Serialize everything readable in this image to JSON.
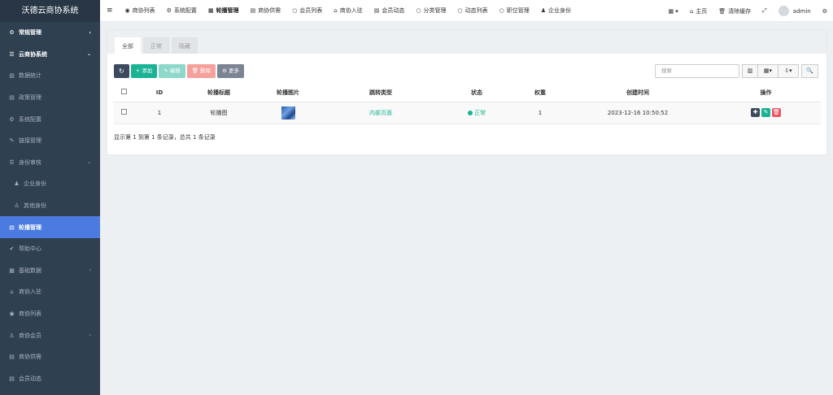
{
  "app": {
    "title": "沃德云商协系统"
  },
  "sidebar": {
    "items": [
      {
        "icon": "⚙",
        "label": "常规管理",
        "arrow": "‹",
        "kind": "head"
      },
      {
        "icon": "☰",
        "label": "云商协系统",
        "arrow": "⌄",
        "kind": "head"
      },
      {
        "icon": "▥",
        "label": "数据统计",
        "kind": ""
      },
      {
        "icon": "▤",
        "label": "政策管理",
        "kind": ""
      },
      {
        "icon": "⚙",
        "label": "系统配置",
        "kind": ""
      },
      {
        "icon": "✎",
        "label": "链接管理",
        "kind": ""
      },
      {
        "icon": "☰",
        "label": "身份审核",
        "arrow": "⌄",
        "kind": ""
      },
      {
        "icon": "♟",
        "label": "企业身份",
        "kind": "sub"
      },
      {
        "icon": "♙",
        "label": "其他身份",
        "kind": "sub"
      },
      {
        "icon": "▤",
        "label": "轮播管理",
        "kind": "active"
      },
      {
        "icon": "✔",
        "label": "帮助中心",
        "kind": ""
      },
      {
        "icon": "▦",
        "label": "基础数据",
        "arrow": "‹",
        "kind": ""
      },
      {
        "icon": "⌂",
        "label": "商协入驻",
        "kind": ""
      },
      {
        "icon": "◉",
        "label": "商协列表",
        "kind": ""
      },
      {
        "icon": "♙",
        "label": "商协会员",
        "arrow": "‹",
        "kind": ""
      },
      {
        "icon": "▤",
        "label": "商协供需",
        "kind": ""
      },
      {
        "icon": "▤",
        "label": "会员动态",
        "kind": ""
      }
    ]
  },
  "topbar": {
    "menu_icon": "≡",
    "items": [
      {
        "icon": "◉",
        "label": "商协列表"
      },
      {
        "icon": "⚙",
        "label": "系统配置"
      },
      {
        "icon": "▦",
        "label": "轮播管理",
        "active": true
      },
      {
        "icon": "▤",
        "label": "商协供需"
      },
      {
        "icon": "○",
        "label": "会员列表"
      },
      {
        "icon": "⌂",
        "label": "商协入驻"
      },
      {
        "icon": "▤",
        "label": "会员动态"
      },
      {
        "icon": "○",
        "label": "分类管理"
      },
      {
        "icon": "○",
        "label": "动态列表"
      },
      {
        "icon": "○",
        "label": "职位管理"
      },
      {
        "icon": "♟",
        "label": "企业身份"
      }
    ],
    "right": {
      "grid": "▦ ▾",
      "home_icon": "⌂",
      "home": "主页",
      "trash_icon": "🗑",
      "clear": "清除缓存",
      "fullscreen": "⤢",
      "user": "admin",
      "settings": "⚙"
    }
  },
  "tabs": [
    {
      "label": "全部",
      "active": true
    },
    {
      "label": "正常"
    },
    {
      "label": "隐藏"
    }
  ],
  "toolbar": {
    "refresh": "↻",
    "add": "+ 添加",
    "edit": "✎ 编辑",
    "delete": "🗑 删除",
    "more": "⚙ 更多"
  },
  "search": {
    "placeholder": "搜索"
  },
  "right_buttons": {
    "list": "▥",
    "columns": "▦▾",
    "export": "⇩▾",
    "search": "🔍"
  },
  "table": {
    "headers": [
      "ID",
      "轮播标题",
      "轮播图片",
      "跳转类型",
      "状态",
      "权重",
      "创建时间",
      "操作"
    ],
    "rows": [
      {
        "id": "1",
        "title": "轮播图",
        "type": "内部页面",
        "status": "正常",
        "weight": "1",
        "created": "2023-12-16 10:50:52"
      }
    ]
  },
  "ops": {
    "drag": "✚",
    "edit": "✎",
    "del": "🗑"
  },
  "footer": "显示第 1 到第 1 条记录，总共 1 条记录",
  "colors": {
    "sidebar": "#2f4050",
    "active": "#4b7be0",
    "green": "#1ab394"
  }
}
